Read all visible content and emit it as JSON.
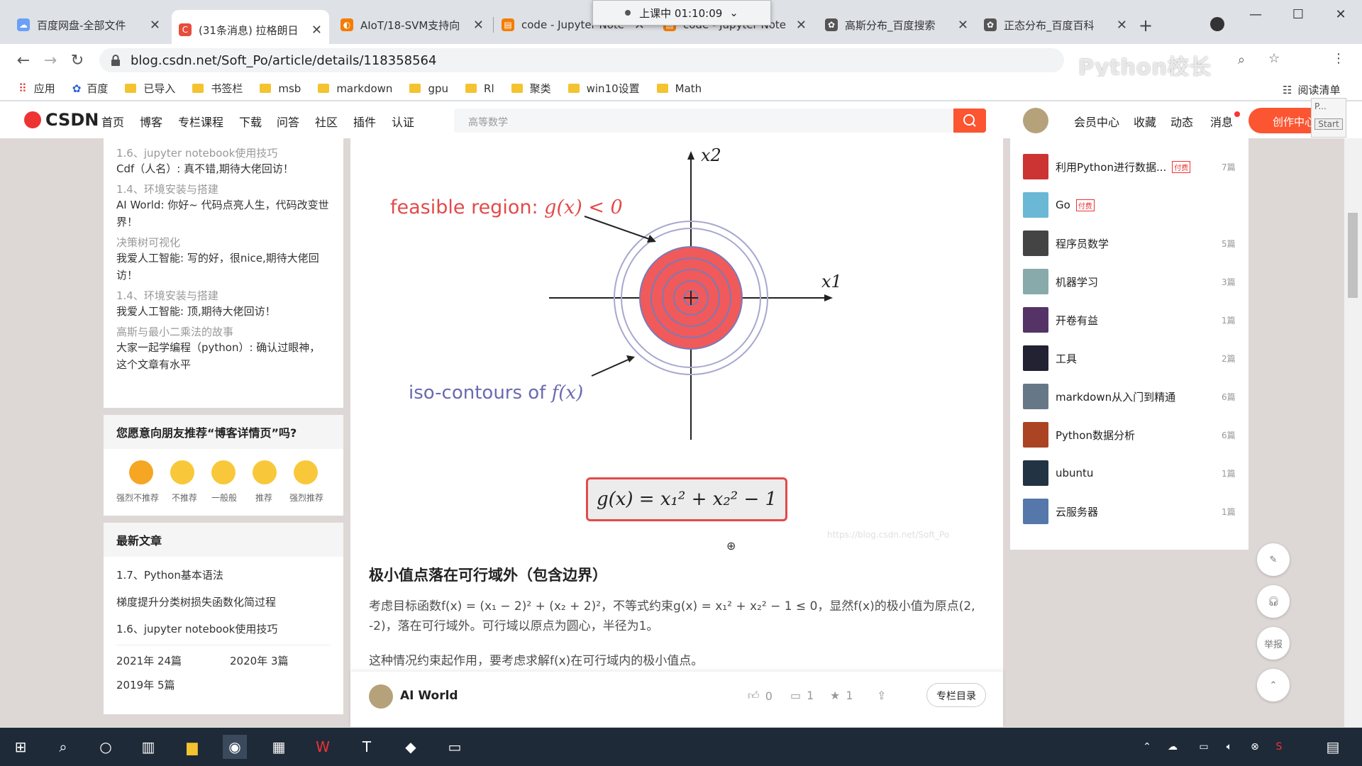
{
  "clock": {
    "label": "上课中 01:10:09"
  },
  "tabs": [
    {
      "title": "百度网盘-全部文件",
      "color": "#6aa0f7"
    },
    {
      "title": "(31条消息) 拉格朗日",
      "color": "#e74c3c"
    },
    {
      "title": "AIoT/18-SVM支持向",
      "color": "#f57c00"
    },
    {
      "title": "code - Jupyter Note",
      "color": "#f57c00"
    },
    {
      "title": "code - Jupyter Note",
      "color": "#f57c00"
    },
    {
      "title": "高斯分布_百度搜索",
      "color": "#555"
    },
    {
      "title": "正态分布_百度百科",
      "color": "#555"
    }
  ],
  "url": "blog.csdn.net/Soft_Po/article/details/118358564",
  "watermark": "Python校长",
  "bookmarks": [
    "应用",
    "百度",
    "已导入",
    "书签栏",
    "msb",
    "markdown",
    "gpu",
    "Rl",
    "聚类",
    "win10设置",
    "Math"
  ],
  "reading_list": "阅读清单",
  "start_popup": "Start",
  "csdn": {
    "logo": "CSDN",
    "nav": [
      "首页",
      "博客",
      "专栏课程",
      "下载",
      "问答",
      "社区",
      "插件",
      "认证"
    ],
    "search_placeholder": "高等数学",
    "user_nav": [
      "会员中心",
      "收藏",
      "动态",
      "消息"
    ],
    "create": "创作中心"
  },
  "left": {
    "comments": [
      {
        "post": "1.6、jupyter notebook使用技巧",
        "text": "Cdf（人名）: 真不错,期待大佬回访！"
      },
      {
        "post": "1.4、环境安装与搭建",
        "text": "AI World: 你好~ 代码点亮人生，代码改变世界！"
      },
      {
        "post": "决策树可视化",
        "text": "我爱人工智能: 写的好，很nice,期待大佬回访！"
      },
      {
        "post": "1.4、环境安装与搭建",
        "text": "我爱人工智能: 顶,期待大佬回访！"
      },
      {
        "post": "高斯与最小二乘法的故事",
        "text": "大家一起学编程（python）: 确认过眼神，这个文章有水平"
      }
    ],
    "recommend_title": "您愿意向朋友推荐“博客详情页”吗?",
    "ratings": [
      "强烈不推荐",
      "不推荐",
      "一般般",
      "推荐",
      "强烈推荐"
    ],
    "latest_title": "最新文章",
    "latest": [
      "1.7、Python基本语法",
      "梯度提升分类树损失函数化简过程",
      "1.6、jupyter notebook使用技巧"
    ],
    "archives": [
      {
        "year": "2021年",
        "count": "24篇"
      },
      {
        "year": "2020年",
        "count": "3篇"
      },
      {
        "year": "2019年",
        "count": "5篇"
      }
    ]
  },
  "figure": {
    "feasible": "feasible region:",
    "feasible_math": "g(x) < 0",
    "iso": "iso-contours of",
    "iso_math": "f(x)",
    "x1": "x1",
    "x2": "x2",
    "formula": "g(x) = x₁² + x₂² − 1",
    "watermark": "https://blog.csdn.net/Soft_Po"
  },
  "article": {
    "heading": "极小值点落在可行域外（包含边界）",
    "p1": "考虑目标函数f(x) = (x₁ − 2)² + (x₂ + 2)²，不等式约束g(x) = x₁² + x₂² − 1 ≤ 0，显然f(x)的极小值为原点(2, -2)，落在可行域外。可行域以原点为圆心，半径为1。",
    "p2": "这种情况约束起作用，要考虑求解f(x)在可行域内的极小值点。"
  },
  "footer": {
    "author": "AI World",
    "likes": "0",
    "comments": "1",
    "stars": "1",
    "catalog": "专栏目录"
  },
  "right": {
    "columns": [
      {
        "name": "利用Python进行数据...",
        "count": "7篇"
      },
      {
        "name": "Go",
        "count": ""
      },
      {
        "name": "程序员数学",
        "count": "5篇"
      },
      {
        "name": "机器学习",
        "count": "3篇"
      },
      {
        "name": "开卷有益",
        "count": "1篇"
      },
      {
        "name": "工具",
        "count": "2篇"
      },
      {
        "name": "markdown从入门到精通",
        "count": "6篇"
      },
      {
        "name": "Python数据分析",
        "count": "6篇"
      },
      {
        "name": "ubuntu",
        "count": "1篇"
      },
      {
        "name": "云服务器",
        "count": "1篇"
      }
    ],
    "paid_badge": "付费",
    "report": "举报"
  }
}
